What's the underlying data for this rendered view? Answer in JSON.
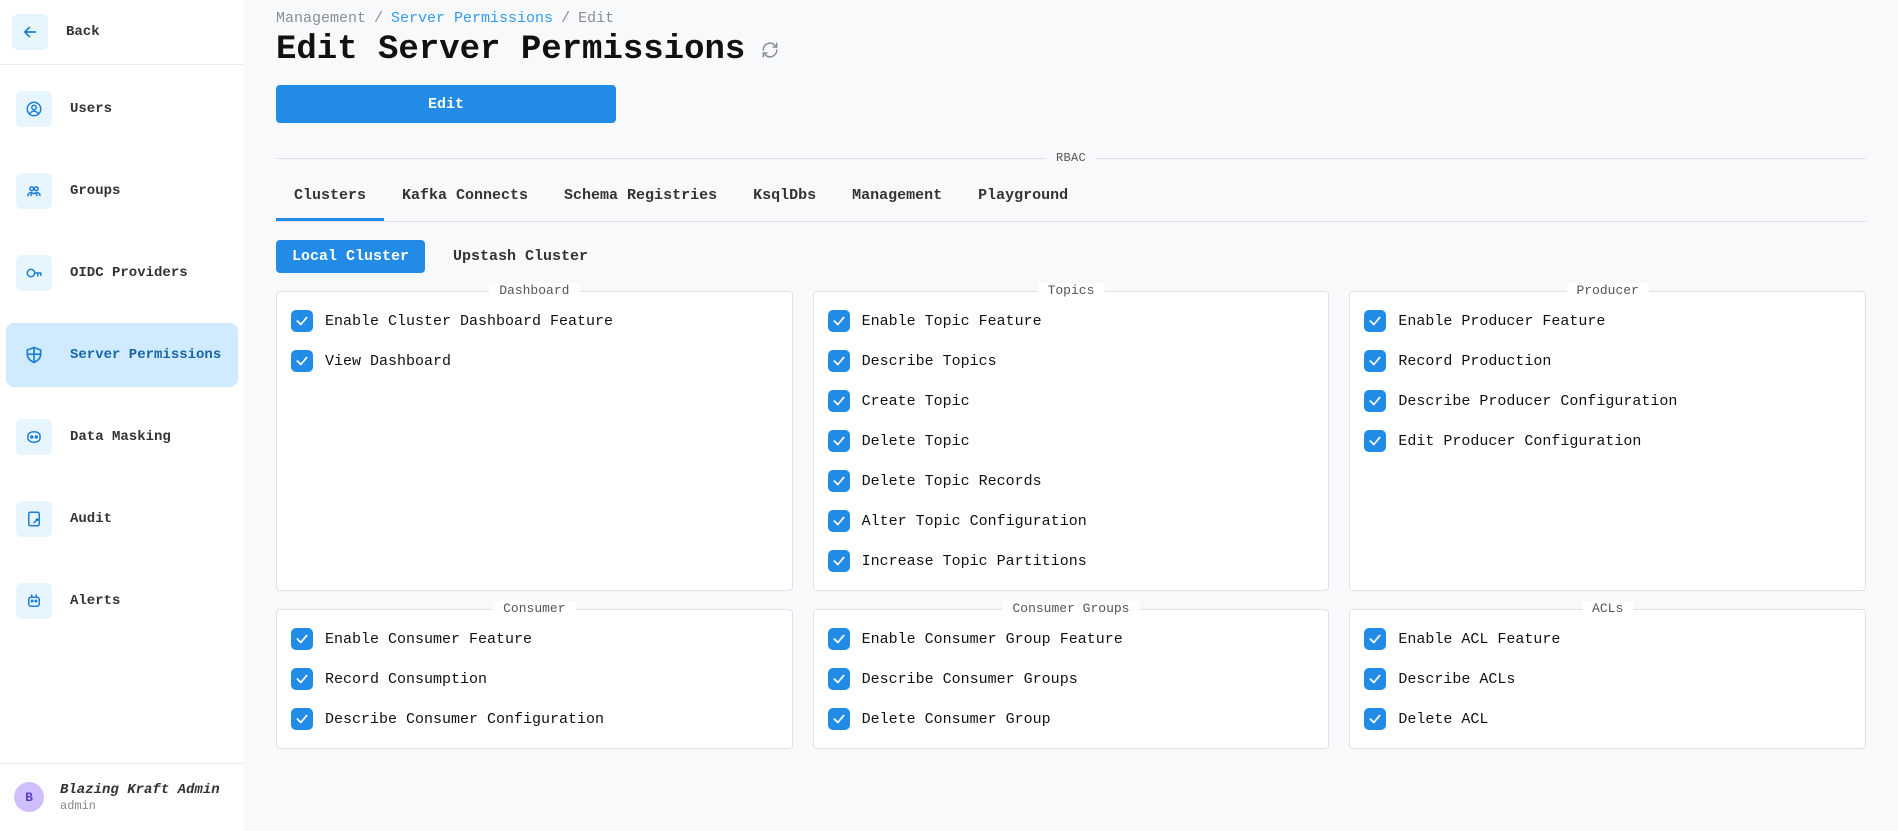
{
  "sidebar": {
    "back_label": "Back",
    "items": [
      {
        "id": "users",
        "label": "Users"
      },
      {
        "id": "groups",
        "label": "Groups"
      },
      {
        "id": "oidc",
        "label": "OIDC Providers"
      },
      {
        "id": "server-permissions",
        "label": "Server Permissions",
        "active": true
      },
      {
        "id": "data-masking",
        "label": "Data Masking"
      },
      {
        "id": "audit",
        "label": "Audit"
      },
      {
        "id": "alerts",
        "label": "Alerts"
      }
    ],
    "user_initial": "B",
    "user_name": "Blazing Kraft Admin",
    "user_role": "admin"
  },
  "breadcrumb": {
    "parent": "Management",
    "link": "Server Permissions",
    "current": "Edit",
    "sep": "/"
  },
  "page": {
    "title": "Edit Server Permissions",
    "edit_button": "Edit",
    "section_label": "RBAC"
  },
  "tabs": [
    {
      "id": "clusters",
      "label": "Clusters",
      "active": true
    },
    {
      "id": "connects",
      "label": "Kafka Connects"
    },
    {
      "id": "schemas",
      "label": "Schema Registries"
    },
    {
      "id": "ksql",
      "label": "KsqlDbs"
    },
    {
      "id": "mgmt",
      "label": "Management"
    },
    {
      "id": "playground",
      "label": "Playground"
    }
  ],
  "subtabs": [
    {
      "id": "local",
      "label": "Local Cluster",
      "active": true
    },
    {
      "id": "upstash",
      "label": "Upstash Cluster"
    }
  ],
  "permission_groups_row1": [
    {
      "title": "Dashboard",
      "permissions": [
        "Enable Cluster Dashboard Feature",
        "View Dashboard"
      ]
    },
    {
      "title": "Topics",
      "permissions": [
        "Enable Topic Feature",
        "Describe Topics",
        "Create Topic",
        "Delete Topic",
        "Delete Topic Records",
        "Alter Topic Configuration",
        "Increase Topic Partitions"
      ]
    },
    {
      "title": "Producer",
      "permissions": [
        "Enable Producer Feature",
        "Record Production",
        "Describe Producer Configuration",
        "Edit Producer Configuration"
      ]
    }
  ],
  "permission_groups_row2": [
    {
      "title": "Consumer",
      "permissions": [
        "Enable Consumer Feature",
        "Record Consumption",
        "Describe Consumer Configuration"
      ]
    },
    {
      "title": "Consumer Groups",
      "permissions": [
        "Enable Consumer Group Feature",
        "Describe Consumer Groups",
        "Delete Consumer Group"
      ]
    },
    {
      "title": "ACLs",
      "permissions": [
        "Enable ACL Feature",
        "Describe ACLs",
        "Delete ACL"
      ]
    }
  ]
}
